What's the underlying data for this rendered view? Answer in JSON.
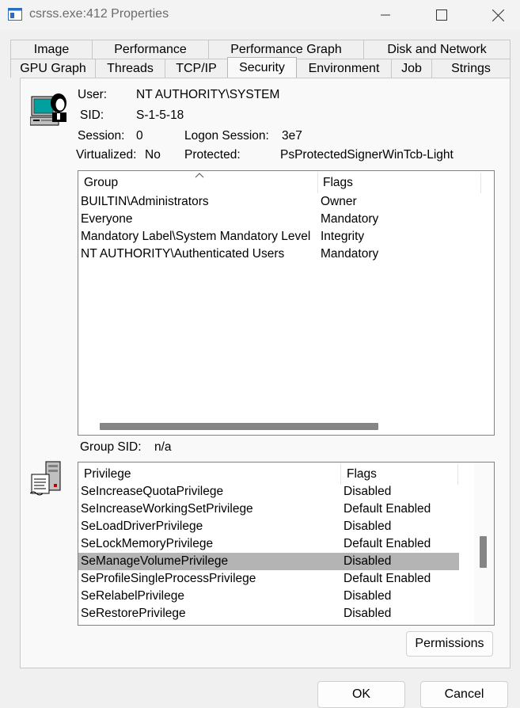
{
  "window": {
    "title": "csrss.exe:412 Properties"
  },
  "tabs_back": [
    "Image",
    "Performance",
    "Performance Graph",
    "Disk and Network"
  ],
  "tabs_front": [
    "GPU Graph",
    "Threads",
    "TCP/IP",
    "Security",
    "Environment",
    "Job",
    "Strings"
  ],
  "active_tab": "Security",
  "identity": {
    "user_label": "User:",
    "user_value": "NT AUTHORITY\\SYSTEM",
    "sid_label": "SID:",
    "sid_value": "S-1-5-18",
    "session_label": "Session:",
    "session_value": "0",
    "logon_label": "Logon Session:",
    "logon_value": "3e7",
    "virtualized_label": "Virtualized:",
    "virtualized_value": "No",
    "protected_label": "Protected:",
    "protected_value": "PsProtectedSignerWinTcb-Light"
  },
  "groups": {
    "col_group": "Group",
    "col_flags": "Flags",
    "rows": [
      {
        "group": "BUILTIN\\Administrators",
        "flags": "Owner"
      },
      {
        "group": "Everyone",
        "flags": "Mandatory"
      },
      {
        "group": "Mandatory Label\\System Mandatory Level",
        "flags": "Integrity"
      },
      {
        "group": "NT AUTHORITY\\Authenticated Users",
        "flags": "Mandatory"
      }
    ],
    "group_sid_label": "Group SID:",
    "group_sid_value": "n/a"
  },
  "privileges": {
    "col_privilege": "Privilege",
    "col_flags": "Flags",
    "rows": [
      {
        "name": "SeIncreaseQuotaPrivilege",
        "flags": "Disabled"
      },
      {
        "name": "SeIncreaseWorkingSetPrivilege",
        "flags": "Default Enabled"
      },
      {
        "name": "SeLoadDriverPrivilege",
        "flags": "Disabled"
      },
      {
        "name": "SeLockMemoryPrivilege",
        "flags": "Default Enabled"
      },
      {
        "name": "SeManageVolumePrivilege",
        "flags": "Disabled",
        "selected": true
      },
      {
        "name": "SeProfileSingleProcessPrivilege",
        "flags": "Default Enabled"
      },
      {
        "name": "SeRelabelPrivilege",
        "flags": "Disabled"
      },
      {
        "name": "SeRestorePrivilege",
        "flags": "Disabled"
      }
    ]
  },
  "buttons": {
    "permissions": "Permissions",
    "ok": "OK",
    "cancel": "Cancel"
  },
  "colors": {
    "selection": "#b4b4b4",
    "scroll_thumb": "#858585"
  }
}
